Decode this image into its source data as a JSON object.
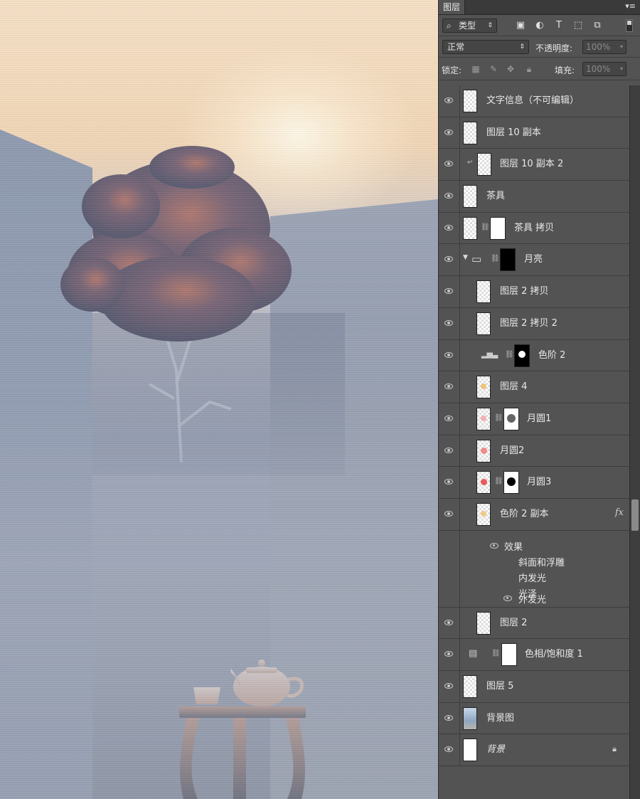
{
  "panel": {
    "tab_label": "图层",
    "filter": {
      "kind_label": "类型"
    },
    "blend_mode": "正常",
    "opacity_label": "不透明度:",
    "opacity_value": "100%",
    "lock_label": "锁定:",
    "fill_label": "填充:",
    "fill_value": "100%"
  },
  "layers": [
    {
      "name": "文字信息（不可编辑）"
    },
    {
      "name": "图层 10 副本"
    },
    {
      "name": "图层 10 副本 2"
    },
    {
      "name": "茶具"
    },
    {
      "name": "茶具 拷贝"
    },
    {
      "name": "月亮"
    },
    {
      "name": "图层 2 拷贝"
    },
    {
      "name": "图层 2 拷贝 2"
    },
    {
      "name": "色阶 2"
    },
    {
      "name": "图层 4"
    },
    {
      "name": "月圆1"
    },
    {
      "name": "月圆2"
    },
    {
      "name": "月圆3"
    },
    {
      "name": "色阶 2 副本",
      "fx": "fx"
    },
    {
      "name": "图层 2"
    },
    {
      "name": "色相/饱和度 1"
    },
    {
      "name": "图层 5"
    },
    {
      "name": "背景图"
    },
    {
      "name": "背景"
    }
  ],
  "effects": {
    "header": "效果",
    "items": [
      "斜面和浮雕",
      "内发光",
      "光泽",
      "外发光"
    ]
  }
}
